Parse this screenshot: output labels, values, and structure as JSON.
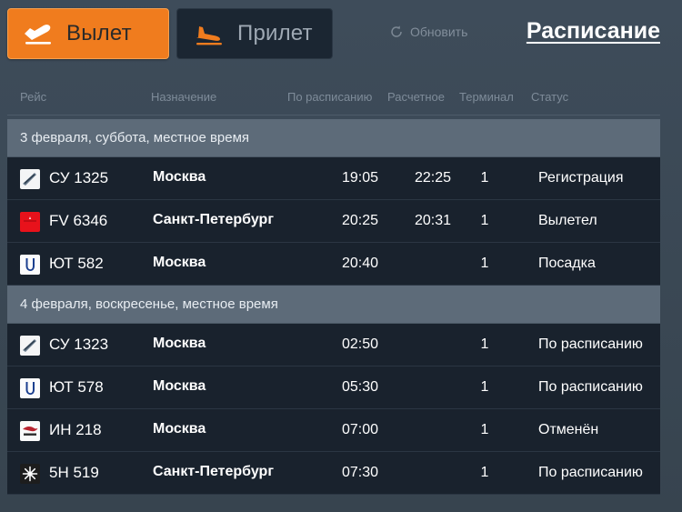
{
  "header": {
    "tabs": [
      {
        "label": "Вылет",
        "icon": "plane-departure-icon",
        "active": true
      },
      {
        "label": "Прилет",
        "icon": "plane-arrival-icon",
        "active": false
      }
    ],
    "refresh_label": "Обновить",
    "refresh_icon": "refresh-icon",
    "schedule_link": "Расписание"
  },
  "columns": {
    "flight": "Рейс",
    "destination": "Назначение",
    "scheduled": "По расписанию",
    "estimated": "Расчетное",
    "terminal": "Терминал",
    "status": "Статус"
  },
  "colors": {
    "accent": "#f07c1e",
    "page_bg": "#3c4a58",
    "row_bg": "#19222d",
    "date_bg": "#5d6b79",
    "text": "#ffffff",
    "muted": "#7e8b99"
  },
  "groups": [
    {
      "date_label": "3 февраля, суббота, местное время",
      "flights": [
        {
          "logo": "aeroflot-logo",
          "flight": "СУ 1325",
          "destination": "Москва",
          "scheduled": "19:05",
          "estimated": "22:25",
          "terminal": "1",
          "status": "Регистрация"
        },
        {
          "logo": "rossiya-logo",
          "flight": "FV 6346",
          "destination": "Санкт-Петербург",
          "scheduled": "20:25",
          "estimated": "20:31",
          "terminal": "1",
          "status": "Вылетел"
        },
        {
          "logo": "utair-logo",
          "flight": "ЮТ 582",
          "destination": "Москва",
          "scheduled": "20:40",
          "estimated": "",
          "terminal": "1",
          "status": "Посадка"
        }
      ]
    },
    {
      "date_label": "4 февраля, воскресенье, местное время",
      "flights": [
        {
          "logo": "aeroflot-logo",
          "flight": "СУ 1323",
          "destination": "Москва",
          "scheduled": "02:50",
          "estimated": "",
          "terminal": "1",
          "status": "По расписанию"
        },
        {
          "logo": "utair-logo",
          "flight": "ЮТ 578",
          "destination": "Москва",
          "scheduled": "05:30",
          "estimated": "",
          "terminal": "1",
          "status": "По расписанию"
        },
        {
          "logo": "nordwind-logo",
          "flight": "ИН 218",
          "destination": "Москва",
          "scheduled": "07:00",
          "estimated": "",
          "terminal": "1",
          "status": "Отменён"
        },
        {
          "logo": "nordavia-logo",
          "flight": "5Н 519",
          "destination": "Санкт-Петербург",
          "scheduled": "07:30",
          "estimated": "",
          "terminal": "1",
          "status": "По расписанию"
        }
      ]
    }
  ]
}
